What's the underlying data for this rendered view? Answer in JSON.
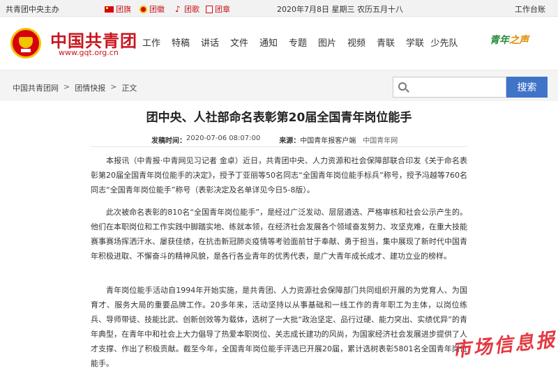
{
  "topbar": {
    "host": "共青团中央主办",
    "flag": "团旗",
    "badge": "团徽",
    "song": "团歌",
    "charter": "团章",
    "date": "2020年7月8日 星期三 农历五月十八",
    "platform": "工作台账"
  },
  "header": {
    "logo_text": "中国共青团",
    "logo_url": "www.gqt.org.cn",
    "nav": [
      "工作",
      "特稿",
      "讲话",
      "文件",
      "通知",
      "专题",
      "图片",
      "视频",
      "青联",
      "学联",
      "少先队"
    ],
    "brand": "青年",
    "brand_mark": "之声"
  },
  "breadcrumb": {
    "items": [
      "中国共青团网",
      "团情快报",
      "正文"
    ],
    "sep": ">"
  },
  "search": {
    "placeholder": "",
    "button": "搜索"
  },
  "article": {
    "title": "团中央、人社部命名表彰第20届全国青年岗位能手",
    "time_label": "发稿时间：",
    "time": "2020-07-06 08:07:00",
    "source_label": "来源：",
    "source": "中国青年报客户端",
    "site": "中国青年网",
    "paragraphs": [
      "本报讯（中青报·中青网见习记者 金卓）近日，共青团中央、人力资源和社会保障部联合印发《关于命名表彰第20届全国青年岗位能手的决定》，授予丁亚丽等50名同志“全国青年岗位能手标兵”称号，授予冯越等760名同志“全国青年岗位能手”称号（表彰决定及名单详见今日5-8版）。",
      "此次被命名表彰的810名“全国青年岗位能手”，是经过广泛发动、层层遴选、严格审核和社会公示产生的。他们在本职岗位和工作实践中脚踏实地、练就本领，在经济社会发展各个领域奋发努力、攻坚克难，在重大技能赛事赛场挥洒汗水、屡获佳绩，在抗击新冠肺炎疫情等考验面前甘于奉献、勇于担当，集中展现了新时代中国青年积极进取、不懈奋斗的精神风貌，是各行各业青年的优秀代表，是广大青年成长成才、建功立业的榜样。",
      "青年岗位能手活动自1994年开始实施，是共青团、人力资源社会保障部门共同组织开展的为党育人、为国育才、服务大局的重要品牌工作。20多年来，活动坚持以从事基础和一线工作的青年职工为主体，以岗位练兵、导师带徒、技能比武、创新创效等为载体，选树了一大批“政治坚定、品行过硬、能力突出、实绩优异”的青年典型，在青年中和社会上大力倡导了热爱本职岗位、关志成长建功的风尚，为国家经济社会发展进步提供了人才支撑、作出了积极贡献。截至今年，全国青年岗位能手评选已开展20届，累计选树表彰5801名全国青年岗位能手。"
    ]
  },
  "watermark": "市场信息报"
}
